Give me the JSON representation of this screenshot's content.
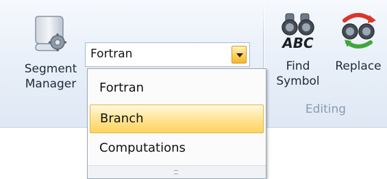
{
  "ribbon": {
    "segment_manager": {
      "line1": "Segment",
      "line2": "Manager",
      "icon": "scroll-gear-icon"
    },
    "find_symbol": {
      "line1": "Find",
      "line2": "Symbol",
      "icon": "binoculars-abc-icon",
      "icon_text": "ABC"
    },
    "replace": {
      "label": "Replace",
      "icon": "binoculars-replace-icon"
    },
    "group_label": "Editing"
  },
  "combo": {
    "value": "Fortran",
    "arrow_icon": "chevron-down-icon"
  },
  "dropdown": {
    "items": [
      {
        "label": "Fortran",
        "selected": false
      },
      {
        "label": "Branch",
        "selected": true
      },
      {
        "label": "Computations",
        "selected": false
      }
    ]
  },
  "colors": {
    "highlight": "#ffd35e",
    "ribbon_bg": "#e9f0f9",
    "group_label": "#8a9bb3"
  }
}
